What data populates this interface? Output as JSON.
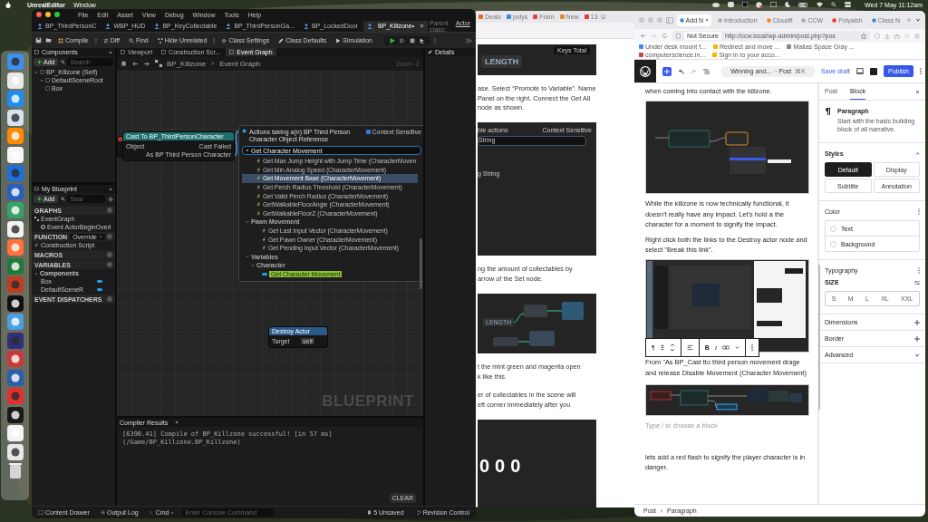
{
  "menubar": {
    "app": "UnrealEditor",
    "menus": [
      "Window"
    ],
    "clock": "Wed 7 May 11:12am"
  },
  "unreal": {
    "menus": [
      "File",
      "Edit",
      "Asset",
      "View",
      "Debug",
      "Window",
      "Tools",
      "Help"
    ],
    "tabs": [
      {
        "label": "BP_ThirdPersonC",
        "selected": false
      },
      {
        "label": "WBP_HUD",
        "selected": false
      },
      {
        "label": "BP_KeyCollectable",
        "selected": false
      },
      {
        "label": "BP_ThirdPersonGa...",
        "selected": false
      },
      {
        "label": "BP_LockedDoor",
        "selected": false
      },
      {
        "label": "BP_Killzone•",
        "selected": true
      }
    ],
    "parent_class": {
      "label": "Parent class:",
      "value": "Actor"
    },
    "toolbar": [
      {
        "kind": "compile",
        "label": "Compile"
      },
      {
        "kind": "diff",
        "label": "Diff"
      },
      {
        "kind": "find",
        "label": "Find"
      },
      {
        "kind": "hide",
        "label": "Hide Unrelated"
      },
      {
        "kind": "settings",
        "label": "Class Settings"
      },
      {
        "kind": "defaults",
        "label": "Class Defaults"
      },
      {
        "kind": "simulation",
        "label": "Simulation"
      }
    ],
    "components": {
      "title": "Components",
      "add": "Add",
      "search_placeholder": "Search",
      "tree": [
        {
          "label": "BP_Killzone (Self)",
          "children": [
            {
              "label": "DefaultSceneRoot",
              "children": [
                {
                  "label": "Box"
                }
              ]
            }
          ]
        }
      ]
    },
    "graph_tabs": [
      {
        "label": "Viewport",
        "selected": false
      },
      {
        "label": "Construction Scr...",
        "selected": false
      },
      {
        "label": "Event Graph",
        "selected": true
      }
    ],
    "breadcrumb": [
      "BP_Killzone",
      "Event Graph"
    ],
    "zoom": "Zoom -2",
    "details": {
      "title": "Details"
    },
    "my_blueprint": {
      "title": "My Blueprint",
      "add": "Add",
      "search_placeholder": "Sear",
      "sections": [
        {
          "title": "GRAPHS",
          "items": [
            {
              "kind": "graph",
              "label": "EventGraph",
              "children": [
                {
                  "kind": "event",
                  "label": "Event ActorBeginOverl"
                }
              ]
            }
          ]
        },
        {
          "title": "FUNCTION",
          "dropdown": "Override",
          "items": [
            {
              "kind": "function",
              "label": "Construction Script"
            }
          ]
        },
        {
          "title": "MACROS"
        },
        {
          "title": "VARIABLES",
          "items": [
            {
              "kind": "category",
              "label": "Components",
              "children": [
                {
                  "kind": "variable",
                  "label": "Box"
                },
                {
                  "kind": "variable",
                  "label": "DefaultSceneR"
                }
              ]
            }
          ]
        },
        {
          "title": "EVENT DISPATCHERS"
        }
      ]
    },
    "nodes": [
      {
        "kind": "cast",
        "title": "Cast To BP_ThirdPersonCharacter",
        "pins": [
          "Object",
          "Cast Failed",
          "As BP Third Person Character"
        ]
      },
      {
        "kind": "call",
        "title": "Destroy Actor",
        "pins": [
          "Target",
          "self"
        ]
      }
    ],
    "graph_watermark": "BLUEPRINT",
    "action_menu": {
      "title": "Actions taking a(n) BP Third Person Character Object Reference",
      "context_sensitive": {
        "label": "Context Sensitive",
        "checked": true
      },
      "search": "Get Character Movement",
      "items": [
        {
          "kind": "function",
          "label": "Get Max Jump Height with Jump Time (CharacterMoven",
          "selected": false
        },
        {
          "kind": "function",
          "label": "Get Min Analog Speed (CharacterMovement)",
          "selected": false
        },
        {
          "kind": "function",
          "label": "Get Movement Base (CharacterMovement)",
          "selected": true
        },
        {
          "kind": "function",
          "label": "Get Perch Radius Threshold (CharacterMovement)",
          "selected": false
        },
        {
          "kind": "function",
          "label": "Get Valid Perch Radius (CharacterMovement)",
          "selected": false
        },
        {
          "kind": "function",
          "label": "GetWalkableFloorAngle (CharacterMovement)",
          "selected": false
        },
        {
          "kind": "function",
          "label": "GetWalkableFloorZ (CharacterMovement)",
          "selected": false
        },
        {
          "kind": "category",
          "label": "Pawn Movement",
          "children": [
            {
              "kind": "function",
              "label": "Get Last Input Vector (CharacterMovement)",
              "selected": false
            },
            {
              "kind": "function",
              "label": "Get Pawn Owner (CharacterMovement)",
              "selected": false
            },
            {
              "kind": "function",
              "label": "Get Pending Input Vector (CharacterMovement)",
              "selected": false
            }
          ]
        },
        {
          "kind": "category",
          "label": "Variables",
          "children": [
            {
              "kind": "category",
              "label": "Character",
              "children": [
                {
                  "kind": "variable",
                  "label": "Get Character Movement",
                  "selected": false
                }
              ]
            }
          ]
        }
      ]
    },
    "compiler": {
      "title": "Compiler Results",
      "log": "[6390.41] Compile of BP_Killzone successful! [in 57 ms] (/Game/BP_Killzone.BP_Killzone)",
      "clear": "CLEAR"
    },
    "status_bar": {
      "content_drawer": "Content Drawer",
      "output_log": "Output Log",
      "cmd": "Cmd",
      "console_placeholder": "Enter Console Command",
      "unsaved": "5 Unsaved",
      "revision": "Revision Control"
    }
  },
  "tutorial_window": {
    "tabs": [
      "Deals",
      "polys",
      "Fram",
      "New",
      "13. U"
    ],
    "blocks": [
      {
        "kind": "length",
        "texts": [
          "Keys Total",
          "LENGTH"
        ]
      },
      {
        "kind": "text",
        "text": "ase. Select “Promote to Variable”. Name\nPanel on the right. Connect the Get All\nnode as shown."
      },
      {
        "kind": "menu",
        "texts": [
          "ble actions",
          "Context Sensitive",
          "String",
          "g String"
        ]
      },
      {
        "kind": "text",
        "text": "ng the amount of collectables by\narrow of the Set node."
      },
      {
        "kind": "graph",
        "texts": [
          "LENGTH"
        ]
      },
      {
        "kind": "text",
        "text": "t the mint green and magenta open\nk like this."
      },
      {
        "kind": "text",
        "text": "er of collectables in the scene will\neft corner immediately after you"
      },
      {
        "kind": "counter",
        "texts": [
          "000"
        ]
      }
    ]
  },
  "wordpress": {
    "tabs": [
      {
        "label": "Add N",
        "selected": true
      },
      {
        "label": "Introduction",
        "selected": false
      },
      {
        "label": "Cloudfl",
        "selected": false
      },
      {
        "label": "CCW",
        "selected": false
      },
      {
        "label": "Polyalsh",
        "selected": false
      },
      {
        "label": "Class N",
        "selected": false
      }
    ],
    "security": "Not Secure",
    "url": "http://ccw.local/wp-admin/post.php?pos",
    "bookmarks": [
      "Under desk mount f...",
      "Redirect and move ...",
      "Matias Space Gray ...",
      "computerscience.in...",
      "Sign in to your acco..."
    ],
    "doc_title": "Winning and...",
    "doc_type": "· Post",
    "shortcut": "⌘K",
    "save_draft": "Save draft",
    "publish": "Publish",
    "content": [
      {
        "kind": "paragraph",
        "text": "when coming into contact with the killzone."
      },
      {
        "kind": "menushot"
      },
      {
        "kind": "paragraph",
        "text": "While the killzone is now technically functional, it doesn't really have any impact. Let's hold a the character for a moment to signify the impact."
      },
      {
        "kind": "paragraph",
        "text": "Right click both the links to the Destroy actor node and select \"Break this link\"."
      },
      {
        "kind": "screenshot"
      },
      {
        "kind": "paragraph",
        "text": "From \"As BP_Cast tto third person movement drage and release Disable Movement (Character Movement)"
      },
      {
        "kind": "graphshot"
      },
      {
        "kind": "placeholder",
        "text": "Type / to choose a block"
      },
      {
        "kind": "paragraph",
        "text": "lets add a red flash to signify the player character is in danger."
      }
    ],
    "block_toolbar": {
      "paragraph": "¶",
      "bold": "B",
      "italic": "I"
    },
    "sidebar": {
      "tabs": [
        {
          "label": "Post",
          "selected": false
        },
        {
          "label": "Block",
          "selected": true
        }
      ],
      "block_name": "Paragraph",
      "block_description": "Start with the basic building block of all narrative.",
      "styles_title": "Styles",
      "styles": [
        {
          "label": "Default",
          "selected": true
        },
        {
          "label": "Display",
          "selected": false
        },
        {
          "label": "Subtitle",
          "selected": false
        },
        {
          "label": "Annotation",
          "selected": false
        }
      ],
      "color_title": "Color",
      "colors": [
        "Text",
        "Background"
      ],
      "typography_title": "Typography",
      "size_label": "SIZE",
      "sizes": [
        "S",
        "M",
        "L",
        "XL",
        "XXL"
      ],
      "panels": [
        {
          "label": "Dimensions",
          "kind": "tools"
        },
        {
          "label": "Border",
          "kind": "tools"
        },
        {
          "label": "Advanced",
          "kind": "section"
        }
      ]
    },
    "breadcrumb": [
      "Post",
      "Paragraph"
    ]
  }
}
